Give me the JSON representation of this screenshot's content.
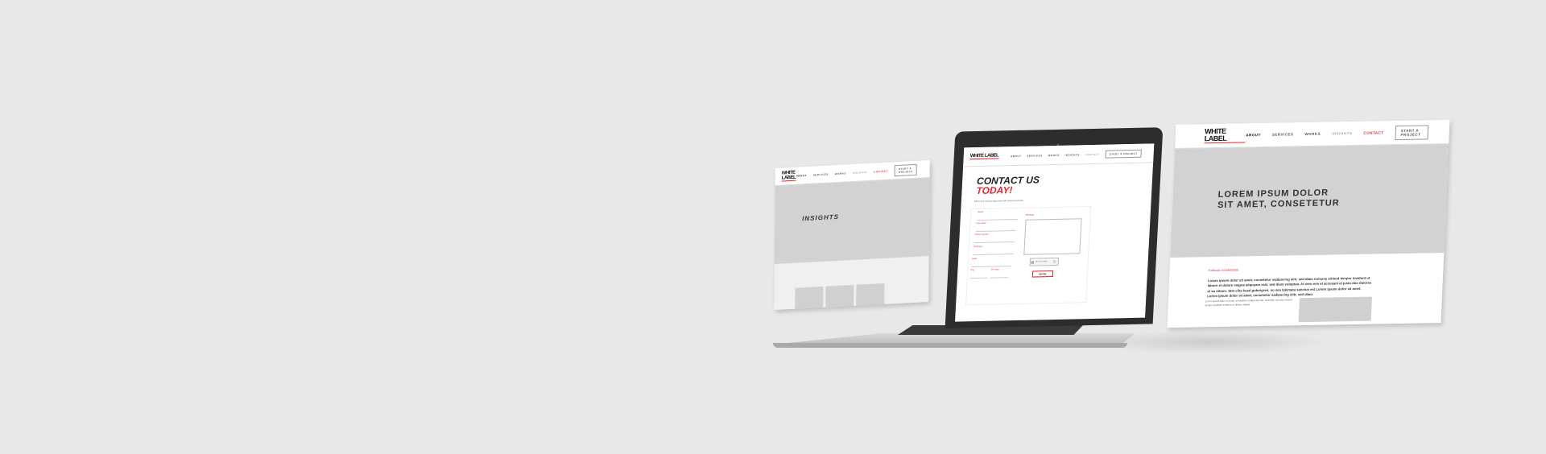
{
  "brand": {
    "logo": "WHITE LABEL",
    "accent": "#e4242b"
  },
  "nav": {
    "items": [
      "About",
      "Services",
      "Works",
      "Insights",
      "Contact"
    ],
    "cta": "Start a project"
  },
  "left_page": {
    "hero_title": "INSIGHTS"
  },
  "laptop_page": {
    "title_line1": "CONTACT US",
    "title_line2": "TODAY!",
    "subtitle": "Fill the form and our sales team will contact you shortly.",
    "fields": [
      "Name",
      "Last name",
      "Phone number",
      "Company",
      "State",
      "City",
      "ZIP code"
    ],
    "message_label": "Message",
    "captcha_label": "I'm not a robot",
    "submit": "Enviar"
  },
  "right_page": {
    "hero_title_line1": "LOREM IPSUM DOLOR",
    "hero_title_line2": "SIT AMET, CONSETETUR",
    "published": "Publicado el 00/00/0000",
    "lead": "Lorem ipsum dolor sit amet, consetetur sadipscing elitr, sed diam nonumy eirmod tempor invidunt ut labore et dolore magna aliquyam erat, sed diam voluptua. At vero eos et accusam et justo duo dolores et ea rebum. Stet clita kasd gubergren, no sea takimata sanctus est Lorem ipsum dolor sit amet. Lorem ipsum dolor sit amet, consetetur sadipscing elitr, sed diam.",
    "body": "Lorem ipsum dolor sit amet, consetetur sadipscing elitr, sed diam nonumy eirmod tempor invidunt ut labore et dolore magna"
  }
}
